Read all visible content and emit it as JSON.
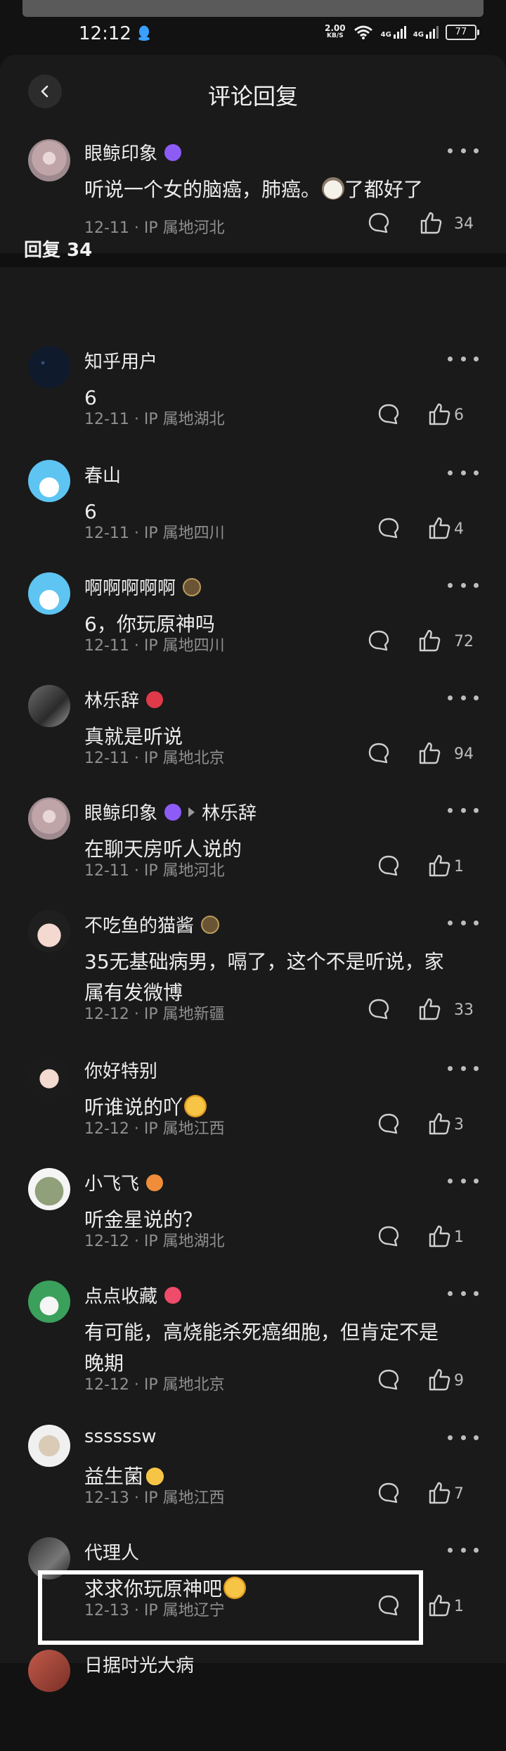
{
  "status_bar": {
    "time": "12:12",
    "speed_value": "2.00",
    "speed_unit": "KB/S",
    "net1": "4G",
    "net2": "4G",
    "battery": "77"
  },
  "header": {
    "title": "评论回复"
  },
  "main_comment": {
    "username": "眼鲸印象",
    "text": "听说一个女的脑癌，肺癌。",
    "text_tail": "了都好了",
    "meta": "12-11 · IP 属地河北",
    "likes": "34"
  },
  "replies_title": "回复 34",
  "replies": [
    {
      "username": "知乎用户",
      "text": "6",
      "meta": "12-11 · IP 属地湖北",
      "likes": "6"
    },
    {
      "username": "春山",
      "text": "6",
      "meta": "12-11 · IP 属地四川",
      "likes": "4"
    },
    {
      "username": "啊啊啊啊啊",
      "text": "6，你玩原神吗",
      "meta": "12-11 · IP 属地四川",
      "likes": "72"
    },
    {
      "username": "林乐辞",
      "text": "真就是听说",
      "meta": "12-11 · IP 属地北京",
      "likes": "94"
    },
    {
      "username": "眼鲸印象",
      "reply_to": "林乐辞",
      "text": "在聊天房听人说的",
      "meta": "12-11 · IP 属地河北",
      "likes": "1"
    },
    {
      "username": "不吃鱼的猫酱",
      "text_line1": "35无基础病男，嗝了，这个不是听说，家",
      "text_line2": "属有发微博",
      "meta": "12-12 · IP 属地新疆",
      "likes": "33"
    },
    {
      "username": "你好特别",
      "text": "听谁说的吖",
      "meta": "12-12 · IP 属地江西",
      "likes": "3"
    },
    {
      "username": "小飞飞",
      "text": "听金星说的？",
      "meta": "12-12 · IP 属地湖北",
      "likes": "1"
    },
    {
      "username": "点点收藏",
      "text_line1": "有可能，高烧能杀死癌细胞，但肯定不是",
      "text_line2": "晚期",
      "meta": "12-12 · IP 属地北京",
      "likes": "9"
    },
    {
      "username": "ssssssw",
      "text": "益生菌",
      "meta": "12-13 · IP 属地江西",
      "likes": "7"
    },
    {
      "username": "代理人",
      "text": "求求你玩原神吧",
      "meta": "12-13 · IP 属地辽宁",
      "likes": "1"
    },
    {
      "username": "日据吋光大病"
    }
  ]
}
